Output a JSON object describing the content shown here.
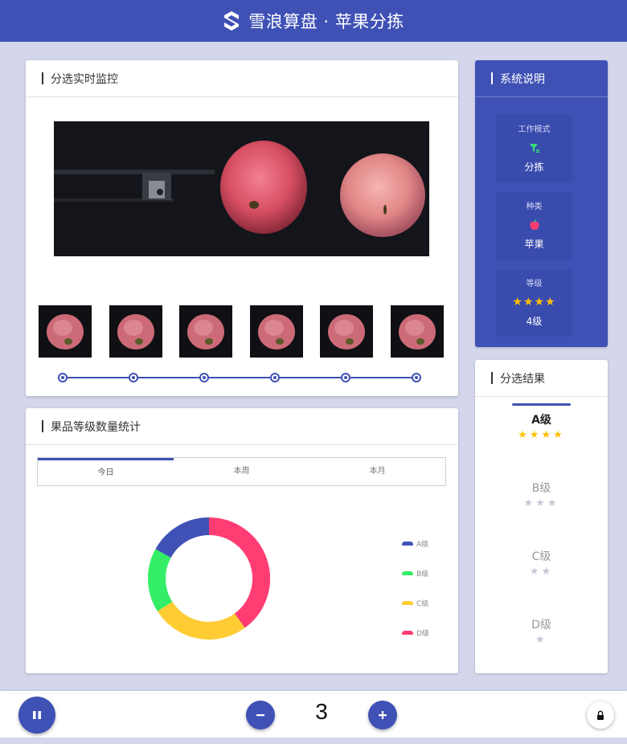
{
  "header": {
    "title": "雪浪算盘 · 苹果分拣",
    "logo_icon": "s-logo-icon"
  },
  "monitor": {
    "title": "分选实时监控",
    "thumbnail_count": 6
  },
  "stats": {
    "title": "果品等级数量统计",
    "tabs": [
      {
        "label": "今日",
        "active": true
      },
      {
        "label": "本周",
        "active": false
      },
      {
        "label": "本月",
        "active": false
      }
    ]
  },
  "chart_data": {
    "type": "pie",
    "donut": true,
    "categories": [
      "A级",
      "B级",
      "C级",
      "D级"
    ],
    "values": [
      17,
      17,
      26,
      40
    ],
    "colors": [
      "#3f51b5",
      "#33ee66",
      "#ffcc33",
      "#ff3d73"
    ],
    "legend_position": "right"
  },
  "system": {
    "title": "系统说明",
    "mode": {
      "label": "工作模式",
      "value": "分拣",
      "icon": "filter-sort-icon"
    },
    "kind": {
      "label": "种类",
      "value": "苹果",
      "icon": "apple-icon"
    },
    "grade": {
      "label": "等级",
      "value": "4级",
      "stars": "★★★★"
    }
  },
  "results": {
    "title": "分选结果",
    "grades": [
      {
        "label": "A级",
        "stars": "★★★★",
        "active": true
      },
      {
        "label": "B级",
        "stars": "★★★",
        "active": false
      },
      {
        "label": "C级",
        "stars": "★★",
        "active": false
      },
      {
        "label": "D级",
        "stars": "★",
        "active": false
      }
    ]
  },
  "controls": {
    "pause_icon": "pause-icon",
    "minus_icon": "minus-icon",
    "plus_icon": "plus-icon",
    "lock_icon": "lock-icon",
    "count": "3"
  },
  "colors": {
    "primary": "#3f51b5",
    "background": "#d4d6ec",
    "star": "#ffc107"
  }
}
